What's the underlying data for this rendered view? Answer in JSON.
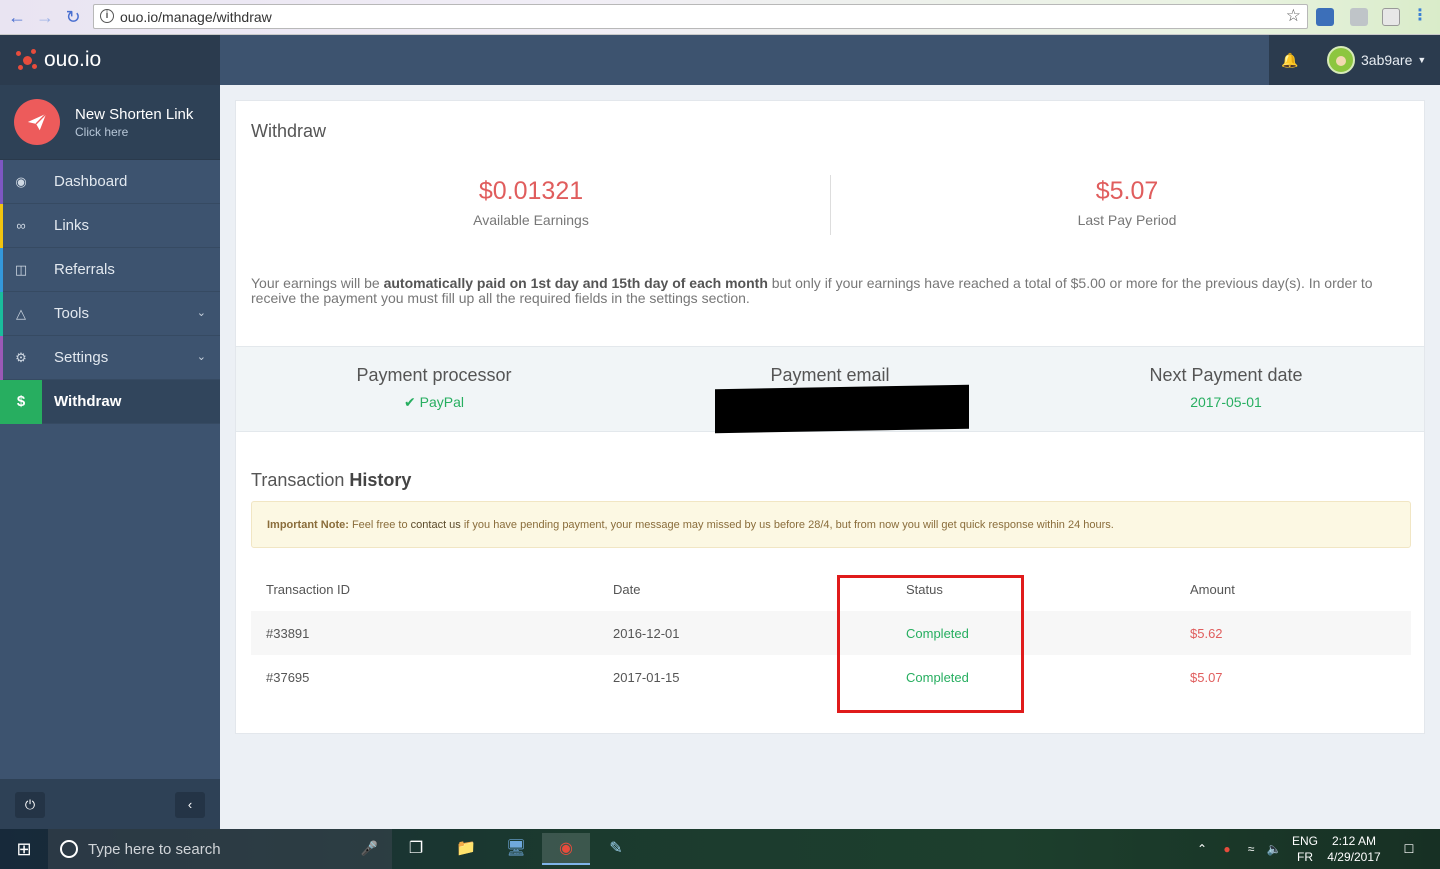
{
  "browser": {
    "url": "ouo.io/manage/withdraw"
  },
  "brand": {
    "name": "ouo.io"
  },
  "shorten": {
    "title": "New Shorten Link",
    "subtitle": "Click here"
  },
  "sidebar": {
    "items": [
      {
        "label": "Dashboard",
        "icon": "dashboard-icon"
      },
      {
        "label": "Links",
        "icon": "link-icon"
      },
      {
        "label": "Referrals",
        "icon": "columns-icon"
      },
      {
        "label": "Tools",
        "icon": "flask-icon"
      },
      {
        "label": "Settings",
        "icon": "gear-icon"
      },
      {
        "label": "Withdraw",
        "icon": "dollar-icon",
        "glyph": "$"
      }
    ]
  },
  "user": {
    "name": "3ab9are"
  },
  "withdraw": {
    "title": "Withdraw",
    "available_value": "$0.01321",
    "available_label": "Available Earnings",
    "last_value": "$5.07",
    "last_label": "Last Pay Period",
    "notice_pre": "Your earnings will be ",
    "notice_bold": "automatically paid on 1st day and 15th day of each month",
    "notice_post": " but only if your earnings have reached a total of $5.00 or more for the previous day(s). In order to receive the payment you must fill up all the required fields in the settings section."
  },
  "payment": {
    "processor_head": "Payment processor",
    "processor_value": "PayPal",
    "email_head": "Payment email",
    "next_head": "Next Payment date",
    "next_value": "2017-05-01"
  },
  "history": {
    "title_light": "Transaction ",
    "title_bold": "History",
    "alert_label": "Important Note:",
    "alert_pre": " Feel free to ",
    "alert_link": "contact us",
    "alert_post": " if you have pending payment, your message may missed by us before 28/4, but from now you will get quick response within 24 hours.",
    "columns": [
      "Transaction ID",
      "Date",
      "Status",
      "Amount"
    ],
    "rows": [
      {
        "id": "#33891",
        "date": "2016-12-01",
        "status": "Completed",
        "amount": "$5.62"
      },
      {
        "id": "#37695",
        "date": "2017-01-15",
        "status": "Completed",
        "amount": "$5.07"
      }
    ]
  },
  "taskbar": {
    "search_placeholder": "Type here to search",
    "lang_top": "ENG",
    "lang_bottom": "FR",
    "time": "2:12 AM",
    "date": "4/29/2017"
  },
  "colors": {
    "sidebar": "#3d536f",
    "accent_red": "#e05d5d",
    "success": "#27ae60",
    "highlight_box": "#e01b1b"
  }
}
